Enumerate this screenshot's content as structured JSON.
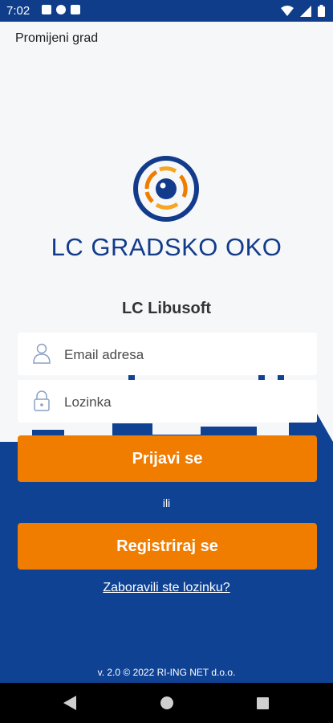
{
  "status_bar": {
    "time": "7:02"
  },
  "header": {
    "change_city": "Promijeni grad"
  },
  "brand": {
    "logo_text": "LC GRADSKO OKO",
    "org_name": "LC Libusoft"
  },
  "form": {
    "email_placeholder": "Email adresa",
    "password_placeholder": "Lozinka",
    "login_label": "Prijavi se",
    "or_label": "ili",
    "register_label": "Registriraj se",
    "forgot_label": "Zaboravili ste lozinku?"
  },
  "footer": {
    "version": "v. 2.0 © 2022 RI-ING NET d.o.o."
  },
  "colors": {
    "primary_blue": "#0f4293",
    "accent_orange": "#f07d00",
    "logo_blue": "#123b8c"
  },
  "icons": [
    "user-icon",
    "lock-icon",
    "wifi-icon",
    "signal-icon",
    "battery-icon",
    "back-icon",
    "home-icon",
    "recents-icon"
  ]
}
